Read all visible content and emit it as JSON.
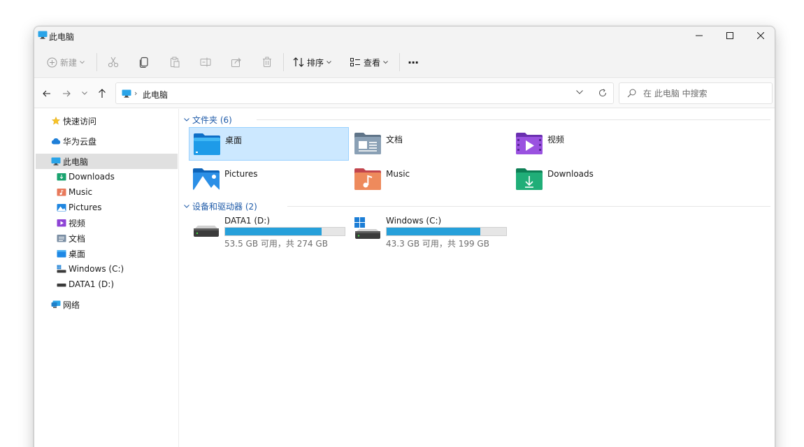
{
  "window": {
    "title": "此电脑"
  },
  "toolbar": {
    "new_label": "新建",
    "sort_label": "排序",
    "view_label": "查看",
    "more_label": "···"
  },
  "address": {
    "crumb": "此电脑"
  },
  "search": {
    "placeholder": "在 此电脑 中搜索"
  },
  "sidebar": {
    "items": [
      {
        "label": "快速访问",
        "icon": "star-icon"
      },
      {
        "label": "华为云盘",
        "icon": "cloud-icon"
      },
      {
        "label": "此电脑",
        "icon": "computer-icon"
      },
      {
        "label": "Downloads",
        "icon": "downloads-folder-icon"
      },
      {
        "label": "Music",
        "icon": "music-folder-icon"
      },
      {
        "label": "Pictures",
        "icon": "pictures-folder-icon"
      },
      {
        "label": "视频",
        "icon": "videos-folder-icon"
      },
      {
        "label": "文档",
        "icon": "documents-folder-icon"
      },
      {
        "label": "桌面",
        "icon": "desktop-folder-icon"
      },
      {
        "label": "Windows (C:)",
        "icon": "windows-drive-icon"
      },
      {
        "label": "DATA1 (D:)",
        "icon": "drive-icon"
      },
      {
        "label": "网络",
        "icon": "network-icon"
      }
    ]
  },
  "folders": {
    "header": "文件夹 (6)",
    "items": [
      {
        "name": "桌面",
        "icon": "desktop-folder-icon",
        "color": "#1e88e5"
      },
      {
        "name": "文档",
        "icon": "documents-folder-icon",
        "color": "#7a8ea3"
      },
      {
        "name": "视频",
        "icon": "videos-folder-icon",
        "color": "#8e44d6"
      },
      {
        "name": "Pictures",
        "icon": "pictures-folder-icon",
        "color": "#1f86e0"
      },
      {
        "name": "Music",
        "icon": "music-folder-icon",
        "color": "#e8795b"
      },
      {
        "name": "Downloads",
        "icon": "downloads-folder-icon",
        "color": "#1aa36f"
      }
    ]
  },
  "drives": {
    "header": "设备和驱动器 (2)",
    "items": [
      {
        "name": "DATA1 (D:)",
        "free_text": "53.5 GB 可用，共 274 GB",
        "used_fraction": 0.805,
        "icon": "drive-icon"
      },
      {
        "name": "Windows (C:)",
        "free_text": "43.3 GB 可用，共 199 GB",
        "used_fraction": 0.782,
        "icon": "windows-drive-icon"
      }
    ]
  },
  "colors": {
    "accent": "#26a0da",
    "selection": "#cce8ff",
    "group_header": "#1e5aa8"
  }
}
